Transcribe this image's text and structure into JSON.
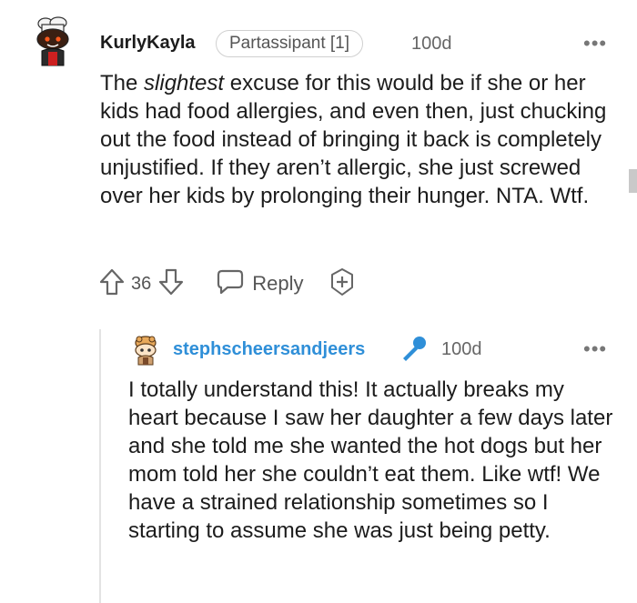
{
  "comment": {
    "author": "KurlyKayla",
    "flair": "Partassipant [1]",
    "time": "100d",
    "more_label": "•••",
    "body_before": "The ",
    "body_emph": "slightest",
    "body_after": " excuse for this would be if she or her kids had food allergies, and even then, just chucking out the food instead of bringing it back is completely unjustified. If they aren’t allergic, she just screwed over her kids by prolonging their hunger. NTA. Wtf.",
    "score": "36",
    "reply_label": "Reply",
    "icons": [
      "avatar-snoo",
      "upvote-icon",
      "downvote-icon",
      "chat-bubble-icon",
      "award-plus-icon",
      "more-icon"
    ]
  },
  "reply": {
    "author": "stephscheersandjeers",
    "author_color": "#2f8fd8",
    "time": "100d",
    "more_label": "•••",
    "body": "I totally understand this! It actually breaks my heart because I saw her daughter a few days later and she told me she wanted the hot dogs but her mom told her she couldn’t eat them. Like wtf! We have a strained relationship sometimes so I starting to assume she was just being petty.",
    "icons": [
      "avatar-snoo",
      "microphone-icon",
      "more-icon"
    ]
  }
}
